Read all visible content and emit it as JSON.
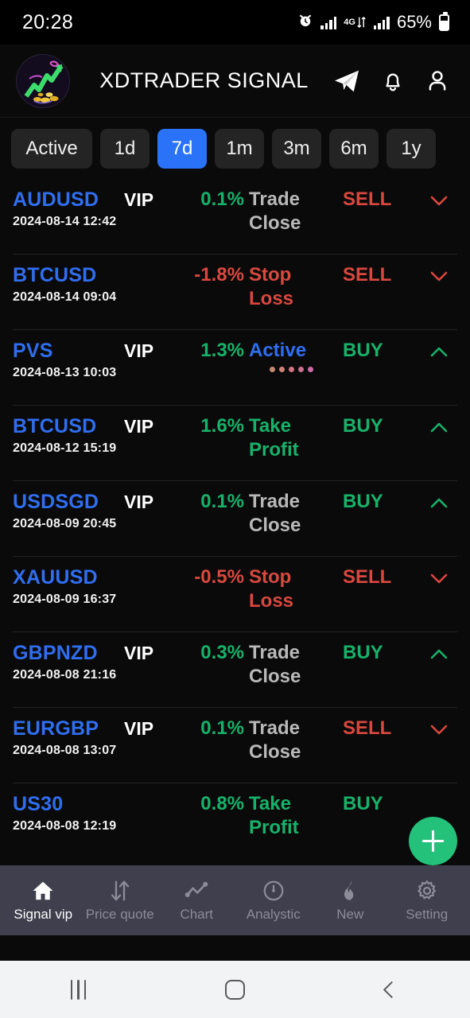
{
  "status_bar": {
    "time": "20:28",
    "battery_percent": "65%",
    "network_label": "4G",
    "icons": [
      "alarm-icon",
      "signal-bars-icon",
      "4g-data-icon",
      "signal-bars-icon",
      "battery-icon"
    ]
  },
  "header": {
    "title": "XDTRADER SIGNAL",
    "logo_name": "xdtrader-logo",
    "icons": [
      {
        "name": "telegram-icon"
      },
      {
        "name": "bell-icon"
      },
      {
        "name": "profile-icon"
      }
    ]
  },
  "filters": {
    "selected": "7d",
    "items": [
      {
        "label": "Active",
        "wide": true
      },
      {
        "label": "1d",
        "wide": false
      },
      {
        "label": "7d",
        "wide": false
      },
      {
        "label": "1m",
        "wide": false
      },
      {
        "label": "3m",
        "wide": false
      },
      {
        "label": "6m",
        "wide": false
      },
      {
        "label": "1y",
        "wide": false
      }
    ]
  },
  "colors": {
    "accent_blue": "#2a72f8",
    "symbol_blue": "#2f6ef0",
    "profit_green": "#17b26a",
    "loss_red": "#d9483f",
    "neutral_grey": "#b9b9b9",
    "fab_green": "#24c17a",
    "nav_bg": "#3f3f4d"
  },
  "signals": [
    {
      "symbol": "AUDUSD",
      "vip": "VIP",
      "datetime": "2024-08-14 12:42",
      "percent": "0.1%",
      "percent_color": "green",
      "status": "Trade Close",
      "status_color": "grey",
      "side": "SELL",
      "side_color": "red",
      "chevron": "chevron-down-icon",
      "chevron_color": "red",
      "loading_dots": false
    },
    {
      "symbol": "BTCUSD",
      "vip": "",
      "datetime": "2024-08-14 09:04",
      "percent": "-1.8%",
      "percent_color": "red",
      "status": "Stop Loss",
      "status_color": "red",
      "side": "SELL",
      "side_color": "red",
      "chevron": "chevron-down-icon",
      "chevron_color": "red",
      "loading_dots": false
    },
    {
      "symbol": "PVS",
      "vip": "VIP",
      "datetime": "2024-08-13 10:03",
      "percent": "1.3%",
      "percent_color": "green",
      "status": "Active",
      "status_color": "blue",
      "side": "BUY",
      "side_color": "green",
      "chevron": "chevron-up-icon",
      "chevron_color": "green",
      "loading_dots": true
    },
    {
      "symbol": "BTCUSD",
      "vip": "VIP",
      "datetime": "2024-08-12 15:19",
      "percent": "1.6%",
      "percent_color": "green",
      "status": "Take Profit",
      "status_color": "green",
      "side": "BUY",
      "side_color": "green",
      "chevron": "chevron-up-icon",
      "chevron_color": "green",
      "loading_dots": false
    },
    {
      "symbol": "USDSGD",
      "vip": "VIP",
      "datetime": "2024-08-09 20:45",
      "percent": "0.1%",
      "percent_color": "green",
      "status": "Trade Close",
      "status_color": "grey",
      "side": "BUY",
      "side_color": "green",
      "chevron": "chevron-up-icon",
      "chevron_color": "green",
      "loading_dots": false
    },
    {
      "symbol": "XAUUSD",
      "vip": "",
      "datetime": "2024-08-09 16:37",
      "percent": "-0.5%",
      "percent_color": "red",
      "status": "Stop Loss",
      "status_color": "red",
      "side": "SELL",
      "side_color": "red",
      "chevron": "chevron-down-icon",
      "chevron_color": "red",
      "loading_dots": false
    },
    {
      "symbol": "GBPNZD",
      "vip": "VIP",
      "datetime": "2024-08-08 21:16",
      "percent": "0.3%",
      "percent_color": "green",
      "status": "Trade Close",
      "status_color": "grey",
      "side": "BUY",
      "side_color": "green",
      "chevron": "chevron-up-icon",
      "chevron_color": "green",
      "loading_dots": false
    },
    {
      "symbol": "EURGBP",
      "vip": "VIP",
      "datetime": "2024-08-08 13:07",
      "percent": "0.1%",
      "percent_color": "green",
      "status": "Trade Close",
      "status_color": "grey",
      "side": "SELL",
      "side_color": "red",
      "chevron": "chevron-down-icon",
      "chevron_color": "red",
      "loading_dots": false
    },
    {
      "symbol": "US30",
      "vip": "",
      "datetime": "2024-08-08 12:19",
      "percent": "0.8%",
      "percent_color": "green",
      "status": "Take Profit",
      "status_color": "green",
      "side": "BUY",
      "side_color": "green",
      "chevron": "",
      "chevron_color": "",
      "loading_dots": false
    }
  ],
  "fab": {
    "name": "add-signal-button",
    "glyph": "+"
  },
  "bottom_nav": {
    "active": "Signal vip",
    "items": [
      {
        "label": "Signal vip",
        "icon": "home-icon"
      },
      {
        "label": "Price quote",
        "icon": "swap-arrows-icon"
      },
      {
        "label": "Chart",
        "icon": "line-chart-icon"
      },
      {
        "label": "Analystic",
        "icon": "gauge-icon"
      },
      {
        "label": "New",
        "icon": "flame-icon"
      },
      {
        "label": "Setting",
        "icon": "gear-icon"
      }
    ]
  },
  "system_nav": {
    "recents": "recents-icon",
    "home": "home-square-icon",
    "back": "back-icon"
  }
}
